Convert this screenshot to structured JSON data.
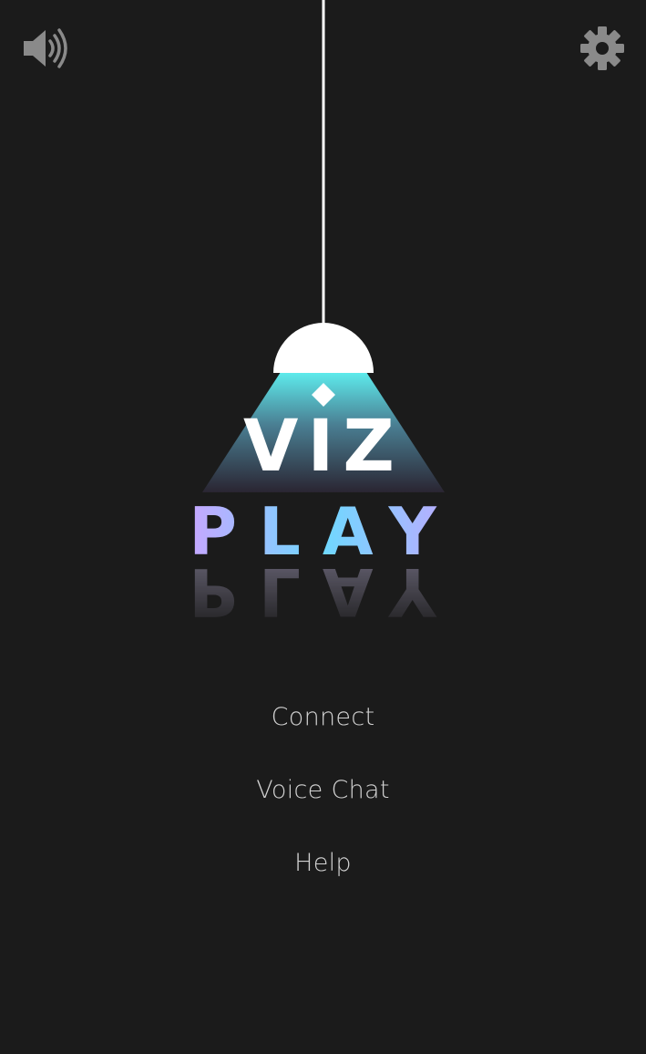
{
  "header": {
    "sound_icon": "speaker-volume-icon",
    "settings_icon": "gear-icon"
  },
  "logo": {
    "word_top": "VIZ",
    "word_bottom": "PLAY"
  },
  "menu": {
    "items": [
      {
        "label": "Connect"
      },
      {
        "label": "Voice Chat"
      },
      {
        "label": "Help"
      }
    ]
  },
  "colors": {
    "background": "#1b1b1b",
    "icon": "#8a8a8a",
    "menu_text": "#d2d2d2",
    "beam_top": "#5ff2f2",
    "play_left": "#c8a6ff",
    "play_right": "#6fd8ff"
  }
}
